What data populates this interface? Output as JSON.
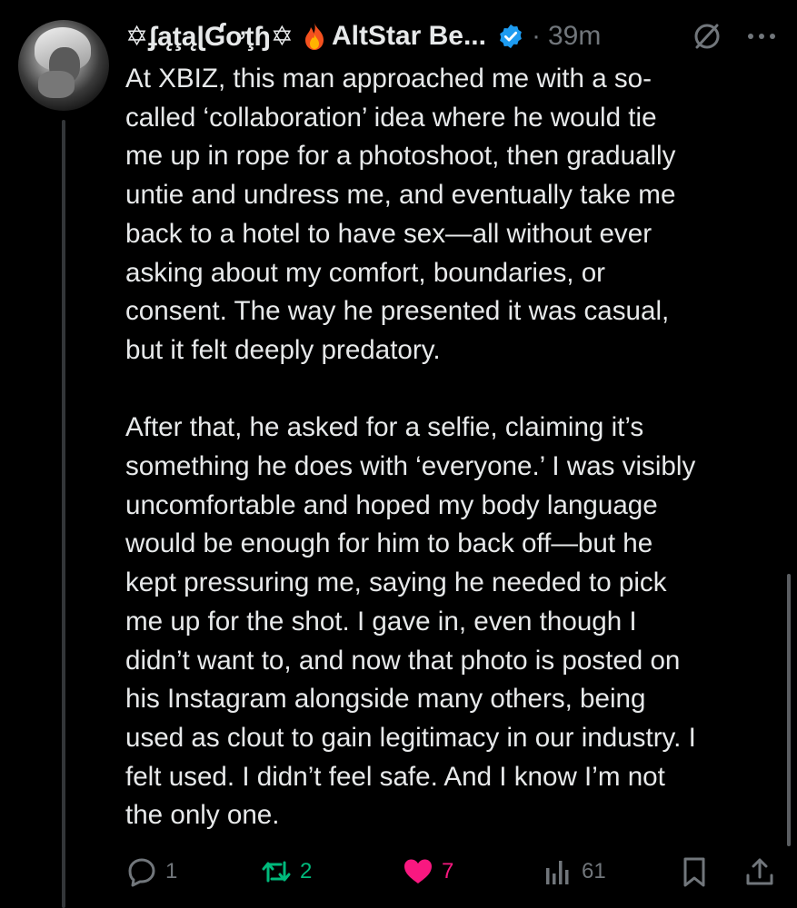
{
  "author": {
    "display_name": "✡ʄąţąɭƓơţɧ✡",
    "company": "AltStar Be...",
    "separator": "·",
    "timestamp": "39m"
  },
  "icons": {
    "emoji": "fire-emoji",
    "verified": "verified-badge-icon",
    "grok": "grok-icon",
    "more": "more-icon"
  },
  "post": {
    "paragraph1": "At XBIZ, this man approached me with a so-\ncalled ‘collaboration’ idea where he would tie\nme up in rope for a photoshoot, then gradually\nuntie and undress me, and eventually take me\nback to a hotel to have sex—all without ever\nasking about my comfort, boundaries, or\nconsent. The way he presented it was casual,\nbut it felt deeply predatory.",
    "paragraph2": "After that, he asked for a selfie, claiming it’s\nsomething he does with ‘everyone.’ I was visibly\nuncomfortable and hoped my body language\nwould be enough for him to back off—but he\nkept pressuring me, saying he needed to pick\nme up for the shot. I gave in, even though I\ndidn’t want to, and now that photo is posted on\nhis Instagram alongside many others, being\nused as clout to gain legitimacy in our industry. I\nfelt used. I didn’t feel safe. And I know I’m not\nthe only one."
  },
  "actions": {
    "reply_count": "1",
    "repost_count": "2",
    "like_count": "7",
    "view_count": "61"
  },
  "colors": {
    "background": "#000000",
    "text": "#e7e9ea",
    "muted": "#71767b",
    "verified": "#1d9bf0",
    "repost": "#00ba7c",
    "like": "#f91880"
  }
}
